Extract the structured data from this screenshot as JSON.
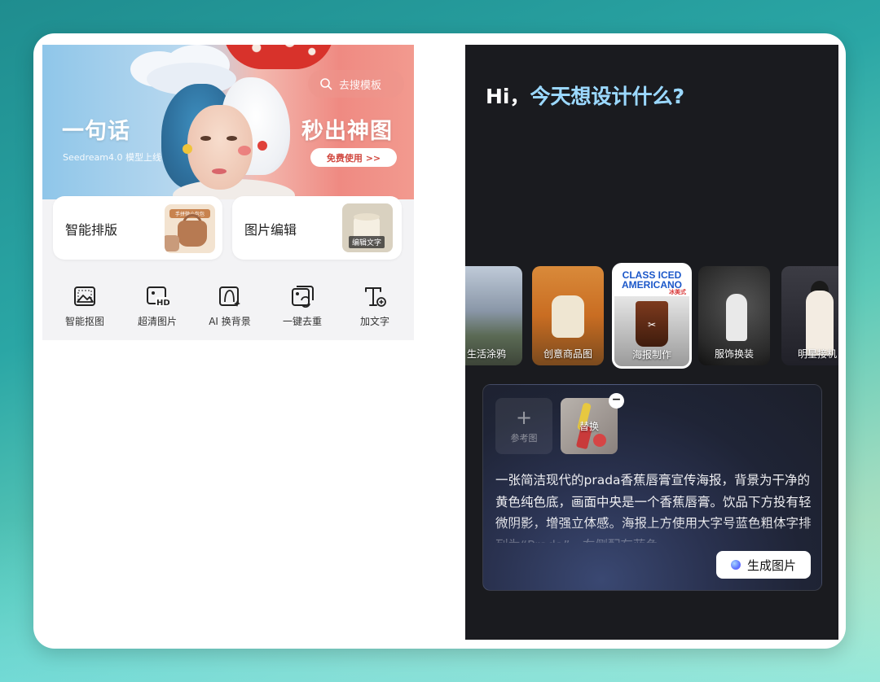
{
  "left_panel": {
    "banner": {
      "title_left": "一句话",
      "subtitle_left": "Seedream4.0 模型上线",
      "title_right": "秒出神图",
      "search_placeholder": "去搜模板",
      "free_button": "免费使用 >>"
    },
    "cards": [
      {
        "label": "智能排版",
        "thumb_tag": "手拼微小包包"
      },
      {
        "label": "图片编辑",
        "thumb_tag": "编辑文字"
      }
    ],
    "tools": [
      {
        "label": "智能抠图",
        "icon": "image-cutout-icon"
      },
      {
        "label": "超清图片",
        "icon": "hd-image-icon"
      },
      {
        "label": "AI 换背景",
        "icon": "ai-background-icon"
      },
      {
        "label": "一键去重",
        "icon": "dedupe-icon"
      },
      {
        "label": "加文字",
        "icon": "add-text-icon"
      }
    ]
  },
  "right_panel": {
    "greeting_prefix": "Hi，",
    "greeting_highlight": "今天想设计什么?",
    "carousel": [
      {
        "label": "生活涂鸦",
        "selected": false
      },
      {
        "label": "创意商品图",
        "selected": false
      },
      {
        "label": "海报制作",
        "selected": true,
        "poster_title": "CLASS ICED AMERICANO",
        "poster_sub": "冰美式"
      },
      {
        "label": "服饰换装",
        "selected": false
      },
      {
        "label": "明星接机",
        "selected": false
      }
    ],
    "prompt": {
      "reference_label": "参考图",
      "reference_plus": "+",
      "image_overlay_label": "替换",
      "remove_symbol": "−",
      "text": "一张简洁现代的prada香蕉唇膏宣传海报，背景为干净的黄色纯色底，画面中央是一个香蕉唇膏。饮品下方投有轻微阴影，增强立体感。海报上方使用大字号蓝色粗体字排列为“Prada”，右侧配有蓝色",
      "generate_button": "生成图片"
    }
  },
  "colors": {
    "accent_blue": "#9bd8ff",
    "dark_panel": "#1a1b1f",
    "banner_pink": "#ef8a82"
  }
}
